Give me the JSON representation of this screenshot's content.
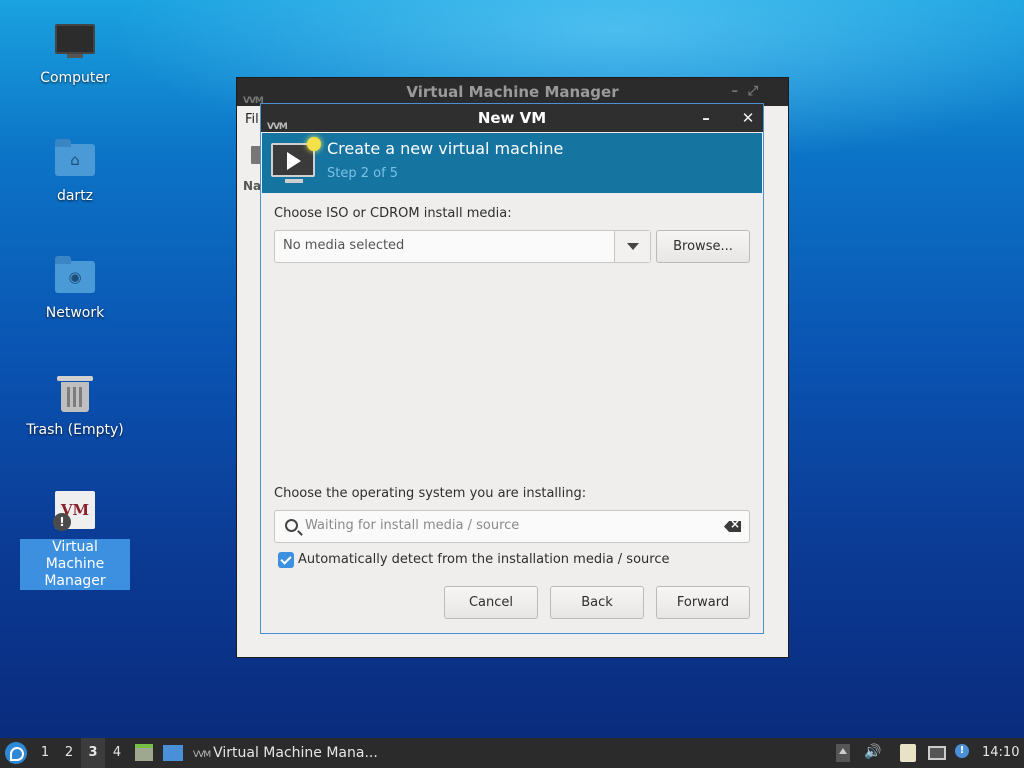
{
  "desktop": {
    "icons": [
      {
        "label": "Computer",
        "glyph": "monitor-icon"
      },
      {
        "label": "dartz",
        "glyph": "home-folder-icon"
      },
      {
        "label": "Network",
        "glyph": "network-folder-icon"
      },
      {
        "label": "Trash (Empty)",
        "glyph": "trash-icon"
      },
      {
        "label": "Virtual Machine Manager",
        "glyph": "virt-manager-icon",
        "selected": true
      }
    ],
    "vmm_logo_text": "VM",
    "vmm_badge": "!"
  },
  "main_window": {
    "title": "Virtual Machine Manager",
    "menu_text": "Fil",
    "column_text": "Na"
  },
  "dialog": {
    "title": "New VM",
    "minimize": "–",
    "close": "✕",
    "banner": {
      "title": "Create a new virtual machine",
      "step": "Step 2 of 5"
    },
    "install_media": {
      "label": "Choose ISO or CDROM install media:",
      "value": "No media selected",
      "browse": "Browse..."
    },
    "os": {
      "label": "Choose the operating system you are installing:",
      "placeholder": "Waiting for install media / source",
      "auto_detect_label": "Automatically detect from the installation media / source",
      "auto_detect_checked": true
    },
    "buttons": {
      "cancel": "Cancel",
      "back": "Back",
      "forward": "Forward"
    }
  },
  "taskbar": {
    "workspaces": [
      "1",
      "2",
      "3",
      "4"
    ],
    "active_workspace": "3",
    "task_label": "Virtual Machine Mana...",
    "clock": "14:10",
    "info_badge": "!"
  },
  "colors": {
    "accent": "#3d8fe0",
    "banner": "#1674a0",
    "taskbar": "#2b2b2b"
  }
}
